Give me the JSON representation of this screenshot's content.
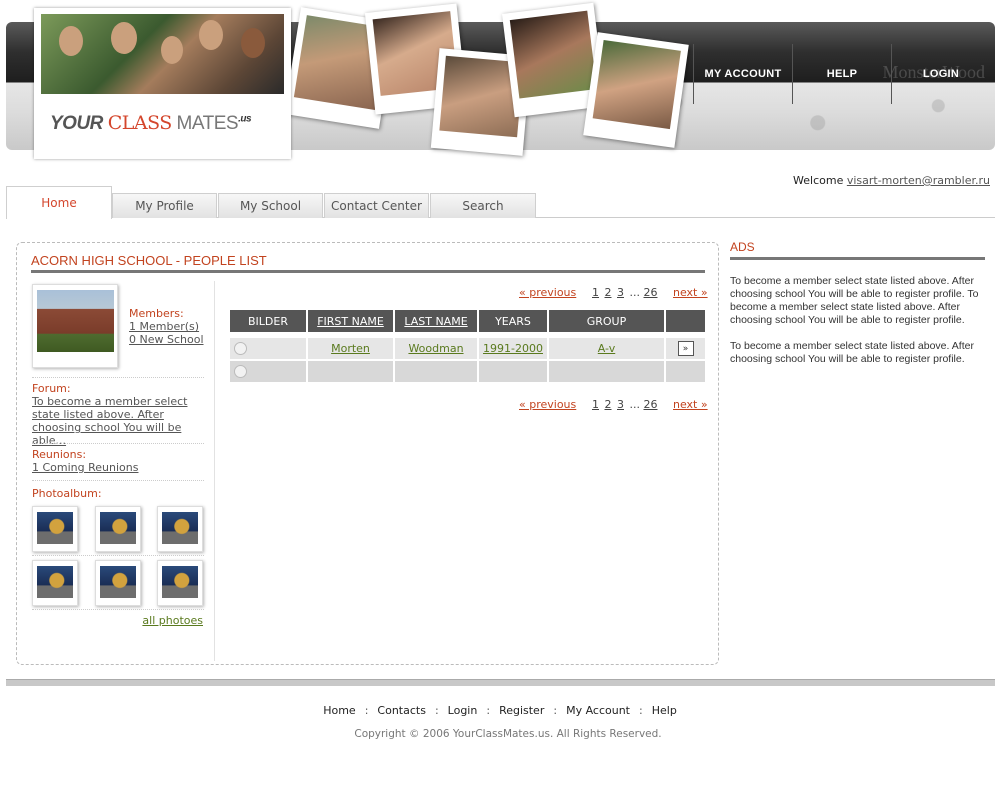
{
  "header": {
    "logo_your": "YOUR",
    "logo_class": "CLASS",
    "logo_mates": "MATES",
    "logo_us": ".us",
    "nav": [
      "MY ACCOUNT",
      "HELP",
      "LOGIN"
    ],
    "brand_ghost": "MonsterWood"
  },
  "welcome": {
    "label": "Welcome",
    "email": "visart-morten@rambler.ru"
  },
  "tabs": [
    "Home",
    "My Profile",
    "My School",
    "Contact Center",
    "Search"
  ],
  "main": {
    "title": "ACORN HIGH SCHOOL - PEOPLE LIST",
    "members_label": "Members:",
    "members_count": "1 Member(s)",
    "new_school": "0 New School",
    "forum_label": "Forum:",
    "forum_text": "To become a member select state listed above. After choosing school You will be able...",
    "reunions_label": "Reunions:",
    "reunions_text": "1 Coming Reunions",
    "photoalbum_label": "Photoalbum:",
    "all_photos": "all photoes"
  },
  "pager": {
    "previous": "« previous",
    "next": "next »",
    "pages": [
      "1",
      "2",
      "3"
    ],
    "ellipsis": "...",
    "last": "26"
  },
  "table": {
    "headers": [
      "BILDER",
      "FIRST NAME",
      "LAST NAME",
      "YEARS",
      "GROUP",
      ""
    ],
    "rows": [
      {
        "first_name": "Morten",
        "last_name": "Woodman",
        "years": "1991-2000",
        "group": "A-v",
        "action": "»"
      }
    ]
  },
  "ads": {
    "title": "ADS",
    "para1": "To become a member select state listed above. After choosing school You will be able to register profile. To become a member select state listed above. After choosing school You will be able to register profile.",
    "para2": "To become a member select state listed above. After choosing school You will be able to register profile."
  },
  "footer": {
    "links": [
      "Home",
      "Contacts",
      "Login",
      "Register",
      "My Account",
      "Help"
    ],
    "separator": ":",
    "copyright": "Copyright © 2006 YourClassMates.us. All Rights Reserved."
  },
  "colors": {
    "accent": "#c2431f",
    "link_green": "#5a7a1e",
    "header_dark": "#2f2f2f"
  }
}
